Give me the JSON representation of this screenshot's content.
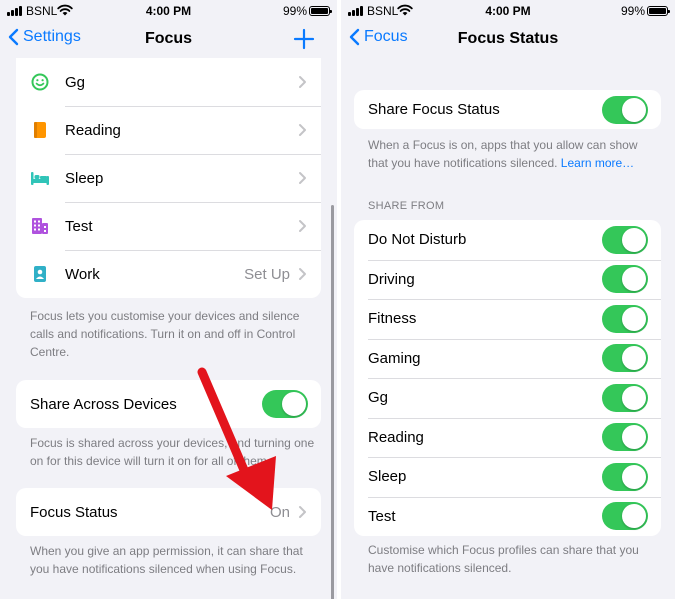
{
  "status_bar": {
    "carrier": "BSNL",
    "time": "4:00 PM",
    "battery": "99%"
  },
  "left": {
    "nav": {
      "back_label": "Settings",
      "title": "Focus"
    },
    "focus_items": [
      {
        "label": "Gg",
        "icon": "smiley-icon",
        "color": "#34c759"
      },
      {
        "label": "Reading",
        "icon": "book-icon",
        "color": "#ff9500"
      },
      {
        "label": "Sleep",
        "icon": "bed-icon",
        "color": "#30c4b8"
      },
      {
        "label": "Test",
        "icon": "building-icon",
        "color": "#af52de"
      },
      {
        "label": "Work",
        "icon": "badge-icon",
        "color": "#30b0c7",
        "value": "Set Up"
      }
    ],
    "focus_footnote": "Focus lets you customise your devices and silence calls and notifications. Turn it on and off in Control Centre.",
    "share_across": {
      "label": "Share Across Devices",
      "on": true
    },
    "share_across_footnote": "Focus is shared across your devices, and turning one on for this device will turn it on for all of them.",
    "focus_status": {
      "label": "Focus Status",
      "value": "On"
    },
    "focus_status_footnote": "When you give an app permission, it can share that you have notifications silenced when using Focus."
  },
  "right": {
    "nav": {
      "back_label": "Focus",
      "title": "Focus Status"
    },
    "share_status": {
      "label": "Share Focus Status",
      "on": true
    },
    "share_status_footnote": "When a Focus is on, apps that you allow can show that you have notifications silenced.",
    "learn_more": "Learn more…",
    "share_from_header": "SHARE FROM",
    "share_from": [
      {
        "label": "Do Not Disturb",
        "on": true
      },
      {
        "label": "Driving",
        "on": true
      },
      {
        "label": "Fitness",
        "on": true
      },
      {
        "label": "Gaming",
        "on": true
      },
      {
        "label": "Gg",
        "on": true
      },
      {
        "label": "Reading",
        "on": true
      },
      {
        "label": "Sleep",
        "on": true
      },
      {
        "label": "Test",
        "on": true
      }
    ],
    "share_from_footnote": "Customise which Focus profiles can share that you have notifications silenced."
  },
  "colors": {
    "accent": "#0a7aff",
    "toggle_on": "#34c759",
    "annotation_arrow": "#e3141c"
  }
}
